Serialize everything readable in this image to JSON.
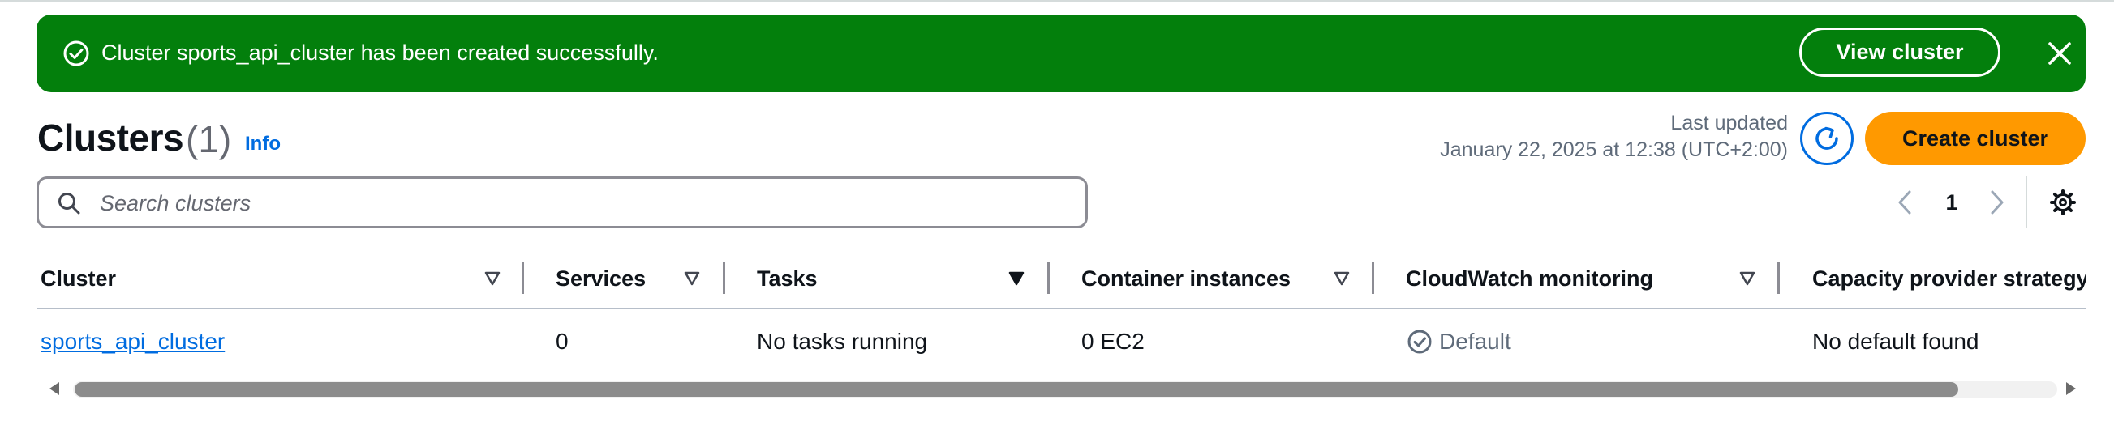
{
  "flash": {
    "message": "Cluster sports_api_cluster has been created successfully.",
    "view_button": "View cluster",
    "status_color": "#037f0c"
  },
  "header": {
    "title": "Clusters",
    "count": "(1)",
    "info": "Info",
    "last_updated_label": "Last updated",
    "last_updated_value": "January 22, 2025 at 12:38 (UTC+2:00)",
    "create_button": "Create cluster",
    "accent_color": "#ff9900",
    "link_color": "#006ce0"
  },
  "search": {
    "placeholder": "Search clusters",
    "value": ""
  },
  "pagination": {
    "current_page": "1"
  },
  "table": {
    "columns": [
      "Cluster",
      "Services",
      "Tasks",
      "Container instances",
      "CloudWatch monitoring",
      "Capacity provider strategy"
    ],
    "rows": [
      {
        "cluster": "sports_api_cluster",
        "services": "0",
        "tasks": "No tasks running",
        "container_instances": "0 EC2",
        "cloudwatch": "Default",
        "capacity_provider": "No default found"
      }
    ]
  },
  "icons": [
    "success-check-icon",
    "close-icon",
    "info-link",
    "refresh-icon",
    "search-icon",
    "chevron-left-icon",
    "chevron-right-icon",
    "gear-icon",
    "sort-icon",
    "check-circle-icon"
  ]
}
